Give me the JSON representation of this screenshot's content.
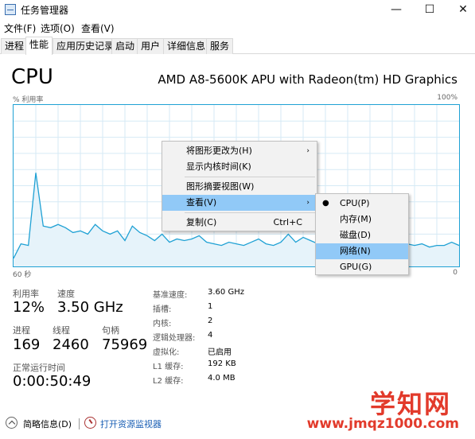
{
  "window": {
    "title": "任务管理器",
    "controls": {
      "minimize": "—",
      "maximize": "☐",
      "close": "✕"
    }
  },
  "menu": [
    "文件(F)",
    "选项(O)",
    "查看(V)"
  ],
  "tabs": [
    "进程",
    "性能",
    "应用历史记录",
    "启动",
    "用户",
    "详细信息",
    "服务"
  ],
  "active_tab": "性能",
  "header": {
    "title": "CPU",
    "model": "AMD A8-5600K APU with Radeon(tm) HD Graphics"
  },
  "graph": {
    "y_label": "% 利用率",
    "y_max_label": "100%",
    "x_left_label": "60 秒",
    "x_right_label": "0",
    "line_color": "#1fa1d4",
    "fill_color": "#e6f3fa",
    "values": [
      5,
      14,
      13,
      58,
      25,
      24,
      26,
      24,
      21,
      22,
      20,
      26,
      22,
      20,
      22,
      16,
      25,
      21,
      19,
      16,
      20,
      15,
      17,
      16,
      17,
      19,
      15,
      14,
      13,
      15,
      14,
      13,
      15,
      17,
      14,
      13,
      15,
      20,
      15,
      18,
      16,
      14,
      15,
      13,
      14,
      13,
      15,
      16,
      13,
      14,
      12,
      13,
      15,
      14,
      13,
      14,
      12,
      13,
      13,
      15,
      13
    ]
  },
  "context_menu": {
    "items": [
      {
        "label": "将图形更改为(H)",
        "arrow": "›",
        "shortcut": ""
      },
      {
        "label": "显示内核时间(K)",
        "arrow": "",
        "shortcut": ""
      },
      {
        "label": "图形摘要视图(W)",
        "arrow": "",
        "shortcut": ""
      },
      {
        "label": "查看(V)",
        "arrow": "›",
        "shortcut": ""
      },
      {
        "label": "复制(C)",
        "arrow": "",
        "shortcut": "Ctrl+C"
      }
    ],
    "submenu": [
      {
        "label": "CPU(P)",
        "bullet": "●"
      },
      {
        "label": "内存(M)",
        "bullet": ""
      },
      {
        "label": "磁盘(D)",
        "bullet": ""
      },
      {
        "label": "网络(N)",
        "bullet": ""
      },
      {
        "label": "GPU(G)",
        "bullet": ""
      }
    ]
  },
  "stats": {
    "utilization_label": "利用率",
    "utilization": "12%",
    "speed_label": "速度",
    "speed": "3.50 GHz",
    "processes_label": "进程",
    "processes": "169",
    "threads_label": "线程",
    "threads": "2460",
    "handles_label": "句柄",
    "handles": "75969",
    "uptime_label": "正常运行时间",
    "uptime": "0:00:50:49"
  },
  "details": [
    {
      "label": "基准速度:",
      "value": "3.60 GHz"
    },
    {
      "label": "插槽:",
      "value": "1"
    },
    {
      "label": "内核:",
      "value": "2"
    },
    {
      "label": "逻辑处理器:",
      "value": "4"
    },
    {
      "label": "虚拟化:",
      "value": "已启用"
    },
    {
      "label": "L1 缓存:",
      "value": "192 KB"
    },
    {
      "label": "L2 缓存:",
      "value": "4.0 MB"
    }
  ],
  "footer": {
    "brief": "简略信息(D)",
    "monitor": "打开资源监视器"
  },
  "watermark": {
    "big": "学知网",
    "small": "www.jmqz1000.com"
  }
}
